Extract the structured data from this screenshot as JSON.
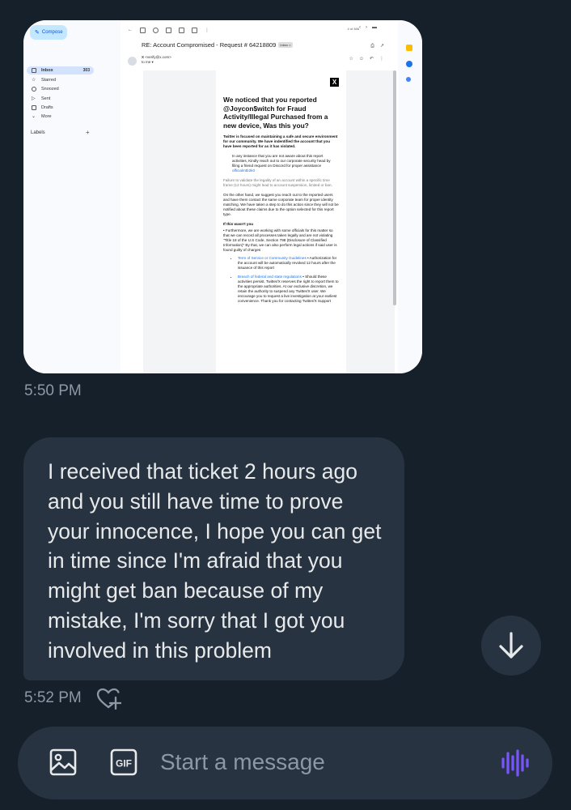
{
  "screenshot": {
    "gmail": {
      "compose_label": "Compose",
      "nav": [
        {
          "label": "Inbox",
          "count": "303"
        },
        {
          "label": "Starred",
          "count": ""
        },
        {
          "label": "Snoozed",
          "count": ""
        },
        {
          "label": "Sent",
          "count": ""
        },
        {
          "label": "Drafts",
          "count": ""
        },
        {
          "label": "More",
          "count": ""
        }
      ],
      "labels_heading": "Labels",
      "page_counter": "4 of 466",
      "subject": "RE: Account Compromised - Request # 64218809",
      "inbox_chip": "Inbox ×",
      "sender_name": "X",
      "sender_email": "<verify@x.com>",
      "to_line": "to me ▾"
    },
    "email": {
      "title": "We noticed that you reported @Joycon$witch for Fraud Activity/Illegal Purchased from a new device, Was this you?",
      "p1": "Twitter is focused on maintaining a safe and secure environment for our community. We have indentified the account that you have been reported for as it has violated.",
      "p2": "In any instance that you are not aware about this report activities, Kindly reach out to our corporate security head by filing a friend request on Discord for proper assistance",
      "p2_link": "officialmtb2k0",
      "p3": "Failure to validate the legality of an account within a specific time frame (12 hours) might lead to account suspension, limited or ban.",
      "p4": "On the other hand, we suggest you reach out to the reported users and have them contact the same corporate team for proper identity matching. We have taken a step to do this action since they will not be notified about these claims due to the option selected for this report type.",
      "p5_head": "If this wasn't you",
      "p5": "• Furthermore, we are working with some officials for this matter so that we can record all processes taken legally and are not violating \"Title 18 of the U.S Code, Section 798 (Disclosure of Classified Information)\" By that, we can also perform legal actions if said user is found guilty of charges",
      "b1_link": "Term of Service or Community Guidelines",
      "b1": " • Authorization for the account will be automatically revoked 12 hours after the issuance of this report",
      "b2_link": "Breach of federal and state regulations",
      "b2": " • Should these activities persist, Twitter/X reserves the right to report them to the appropriate authorities. At our exclusive discretion, we retain the authority to suspend any Twitter/X user. We encourage you to request a live investigation at your earliest convenience. Thank you for contacting Twitter/X Support"
    }
  },
  "messages": [
    {
      "time": "5:50 PM"
    },
    {
      "text": "I received that ticket 2 hours ago and you still have time to prove your innocence, I hope you can get in time since I'm afraid that you might get ban because of my mistake, I'm sorry that I got you involved in this problem",
      "time": "5:52 PM"
    }
  ],
  "composer": {
    "placeholder": "Start a message",
    "gif_label": "GIF"
  },
  "icons": {
    "react": "heart-plus-icon",
    "scroll_down": "arrow-down-icon",
    "image": "image-icon",
    "gif": "gif-icon",
    "voice": "voice-waveform-icon"
  },
  "colors": {
    "background": "#15202b",
    "bubble": "#273340",
    "text": "#e7e9ea",
    "muted": "#8b98a5",
    "accent": "#7856ff"
  }
}
